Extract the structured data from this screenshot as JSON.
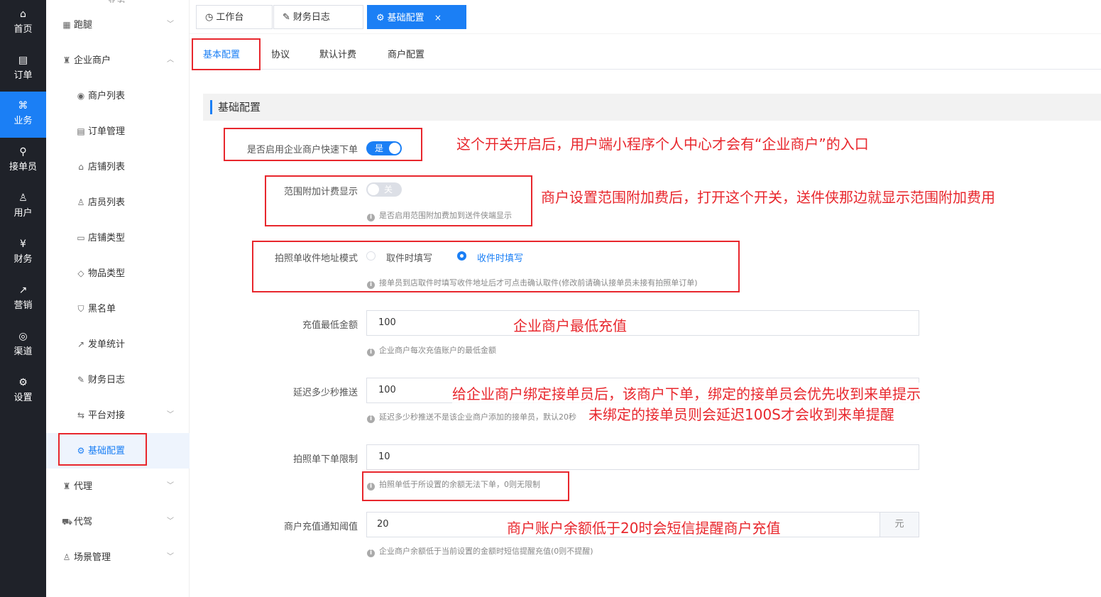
{
  "rail": {
    "items": [
      {
        "label": "首页",
        "icon": "home-icon",
        "glyph": "⌂"
      },
      {
        "label": "订单",
        "icon": "order-icon",
        "glyph": "▤"
      },
      {
        "label": "业务",
        "icon": "business-icon",
        "glyph": "⌘"
      },
      {
        "label": "接单员",
        "icon": "rider-icon",
        "glyph": "⚲"
      },
      {
        "label": "用户",
        "icon": "user-icon",
        "glyph": "♙"
      },
      {
        "label": "财务",
        "icon": "finance-icon",
        "glyph": "¥"
      },
      {
        "label": "营销",
        "icon": "marketing-icon",
        "glyph": "↗"
      },
      {
        "label": "渠道",
        "icon": "channel-icon",
        "glyph": "◎"
      },
      {
        "label": "设置",
        "icon": "settings-icon",
        "glyph": "⚙"
      }
    ],
    "active": "业务"
  },
  "subnav": {
    "partial_top": "业务",
    "items": [
      {
        "label": "跑腿",
        "icon": "errand-icon",
        "glyph": "▦"
      },
      {
        "label": "企业商户",
        "icon": "merchant-icon",
        "glyph": "♜"
      },
      {
        "label": "商户列表",
        "icon": "merchant-list-icon",
        "glyph": "◉"
      },
      {
        "label": "订单管理",
        "icon": "order-manage-icon",
        "glyph": "▤"
      },
      {
        "label": "店铺列表",
        "icon": "shop-list-icon",
        "glyph": "⌂"
      },
      {
        "label": "店员列表",
        "icon": "clerk-list-icon",
        "glyph": "♙"
      },
      {
        "label": "店铺类型",
        "icon": "shop-type-icon",
        "glyph": "▭"
      },
      {
        "label": "物品类型",
        "icon": "item-type-icon",
        "glyph": "◇"
      },
      {
        "label": "黑名单",
        "icon": "blacklist-icon",
        "glyph": "⛉"
      },
      {
        "label": "发单统计",
        "icon": "stats-icon",
        "glyph": "↗"
      },
      {
        "label": "财务日志",
        "icon": "finance-log-icon",
        "glyph": "✎"
      },
      {
        "label": "平台对接",
        "icon": "platform-icon",
        "glyph": "⇆"
      },
      {
        "label": "基础配置",
        "icon": "config-icon",
        "glyph": "⚙"
      },
      {
        "label": "代理",
        "icon": "agent-icon",
        "glyph": "♜"
      },
      {
        "label": "代驾",
        "icon": "driver-icon",
        "glyph": "⛟"
      },
      {
        "label": "场景管理",
        "icon": "scene-icon",
        "glyph": "♙"
      }
    ]
  },
  "top_tabs": [
    {
      "label": "工作台",
      "icon": "dashboard-icon",
      "glyph": "◷"
    },
    {
      "label": "财务日志",
      "icon": "finance-log-icon",
      "glyph": "✎"
    },
    {
      "label": "基础配置",
      "icon": "config-icon",
      "glyph": "⚙",
      "close": "×"
    }
  ],
  "content_tabs": [
    "基本配置",
    "协议",
    "默认计费",
    "商户配置"
  ],
  "section_title": "基础配置",
  "form": {
    "quick_order": {
      "label": "是否启用企业商户快速下单",
      "switch_text": "是"
    },
    "range_fee": {
      "label": "范围附加计费显示",
      "switch_text": "关",
      "hint": "是否启用范围附加费加到送件侠端显示"
    },
    "photo_mode": {
      "label": "拍照单收件地址模式",
      "option1": "取件时填写",
      "option2": "收件时填写",
      "hint": "接单员到店取件时填写收件地址后才可点击确认取件(修改前请确认接单员未接有拍照单订单)"
    },
    "min_recharge": {
      "label": "充值最低金额",
      "value": "100",
      "hint": "企业商户每次充值账户的最低金额"
    },
    "delay_push": {
      "label": "延迟多少秒推送",
      "value": "100",
      "hint": "延迟多少秒推送不是该企业商户添加的接单员，默认20秒"
    },
    "photo_limit": {
      "label": "拍照单下单限制",
      "value": "10",
      "hint": "拍照单低于所设置的余额无法下单，0则无限制"
    },
    "notify_threshold": {
      "label": "商户充值通知阈值",
      "value": "20",
      "unit": "元",
      "hint": "企业商户余额低于当前设置的金额时短信提醒充值(0则不提醒)"
    }
  },
  "annotations": {
    "a1": "这个开关开启后，用户端小程序个人中心才会有“企业商户”的入口",
    "a2": "商户设置范围附加费后，打开这个开关，送件侠那边就显示范围附加费用",
    "a3": "企业商户最低充值",
    "a4": "给企业商户绑定接单员后，该商户下单，绑定的接单员会优先收到来单提示",
    "a5": "未绑定的接单员则会延迟100S才会收到来单提醒",
    "a6": "商户账户余额低于20时会短信提醒商户充值"
  },
  "colors": {
    "accent": "#1b7ff5",
    "annotation": "#e8272d",
    "rail_bg": "#1f2229"
  }
}
